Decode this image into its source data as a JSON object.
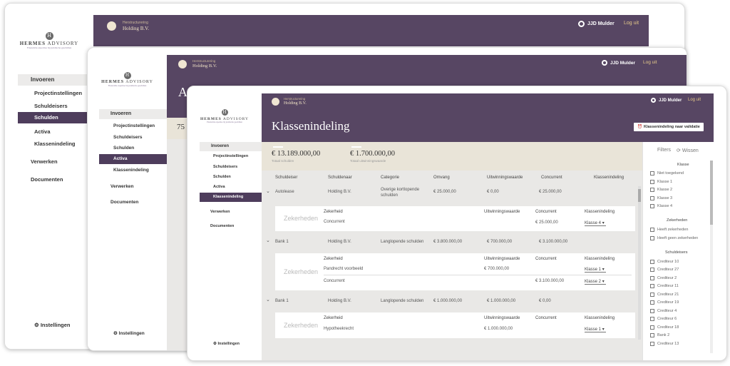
{
  "brand": {
    "name_bold": "HERMES",
    "name_rest": "ADVISORY",
    "tagline": "Financiële expertise bij juridische geschillen",
    "mark": "H"
  },
  "breadcrumb": {
    "small": "Herstructurering",
    "big": "Holding B.V."
  },
  "user": {
    "name": "JJD Mulder",
    "logout": "Log uit"
  },
  "nav": {
    "invoeren": "Invoeren",
    "items": [
      "Projectinstellingen",
      "Schuldeisers",
      "Schulden",
      "Activa",
      "Klassenindeling"
    ],
    "verwerken": "Verwerken",
    "documenten": "Documenten",
    "settings": "Instellingen"
  },
  "win1": {
    "active": "Schulden"
  },
  "win2": {
    "active": "Activa",
    "title_fragment": "A",
    "number_fragment": "75"
  },
  "win3": {
    "active": "Klassenindeling",
    "title": "Klassenindeling",
    "validate_button": "Klassenindeling naar validatie",
    "totals": [
      {
        "value": "€ 13.189.000,00",
        "label": "Totaal schulden"
      },
      {
        "value": "€ 1.700.000,00",
        "label": "Totaal uitwinningswaarde"
      }
    ],
    "columns": [
      "Schuldeiser",
      "Schuldenaar",
      "Categorie",
      "Omvang",
      "Uitwinningswaarde",
      "Concurrent",
      "Klassenindeling"
    ],
    "rows": [
      {
        "schuldeiser": "Autolease",
        "schuldenaar": "Holding B.V.",
        "categorie": "Overige kortlopende schulden",
        "omvang": "€ 25.000,00",
        "uitwinning": "€ 0,00",
        "concurrent": "€ 25.000,00",
        "sub_label": "Zekerheden",
        "sub_headers": [
          "Zekerheid",
          "Uitwinningswaarde",
          "Concurrent",
          "Klassenindeling"
        ],
        "sub_rows": [
          {
            "zekerheid": "Concurrent",
            "uitwinning": "",
            "concurrent": "€ 25.000,00",
            "klasse": "Klasse 4"
          }
        ]
      },
      {
        "schuldeiser": "Bank 1",
        "schuldenaar": "Holding B.V.",
        "categorie": "Langlopende schulden",
        "omvang": "€ 3.800.000,00",
        "uitwinning": "€ 700.000,00",
        "concurrent": "€ 3.100.000,00",
        "sub_label": "Zekerheden",
        "sub_headers": [
          "Zekerheid",
          "Uitwinningswaarde",
          "Concurrent",
          "Klassenindeling"
        ],
        "sub_rows": [
          {
            "zekerheid": "Pandrecht voorbeeld",
            "uitwinning": "€ 700.000,00",
            "concurrent": "",
            "klasse": "Klasse 1"
          },
          {
            "zekerheid": "Concurrent",
            "uitwinning": "",
            "concurrent": "€ 3.100.000,00",
            "klasse": "Klasse 2"
          }
        ]
      },
      {
        "schuldeiser": "Bank 1",
        "schuldenaar": "Holding B.V.",
        "categorie": "Langlopende schulden",
        "omvang": "€ 1.000.000,00",
        "uitwinning": "€ 1.000.000,00",
        "concurrent": "€ 0,00",
        "sub_label": "Zekerheden",
        "sub_headers": [
          "Zekerheid",
          "Uitwinningswaarde",
          "Concurrent",
          "Klassenindeling"
        ],
        "sub_rows": [
          {
            "zekerheid": "Hypotheekrecht",
            "uitwinning": "€ 1.000.000,00",
            "concurrent": "",
            "klasse": "Klasse 1"
          }
        ]
      }
    ],
    "filters": {
      "title": "Filters",
      "clear": "Wissen",
      "klasse_head": "Klasse",
      "klasse": [
        "Niet toegekend",
        "Klasse 1",
        "Klasse 2",
        "Klasse 3",
        "Klasse 4"
      ],
      "zek_head": "Zekerheden",
      "zek": [
        "Heeft zekerheden",
        "Heeft geen zekerheden"
      ],
      "schuld_head": "Schuldeisers",
      "schuldeisers": [
        "Crediteur 10",
        "Crediteur 27",
        "Crediteur 2",
        "Crediteur 11",
        "Crediteur 21",
        "Crediteur 19",
        "Crediteur 4",
        "Crediteur 6",
        "Crediteur 18",
        "Bank 2",
        "Crediteur 13"
      ]
    }
  }
}
